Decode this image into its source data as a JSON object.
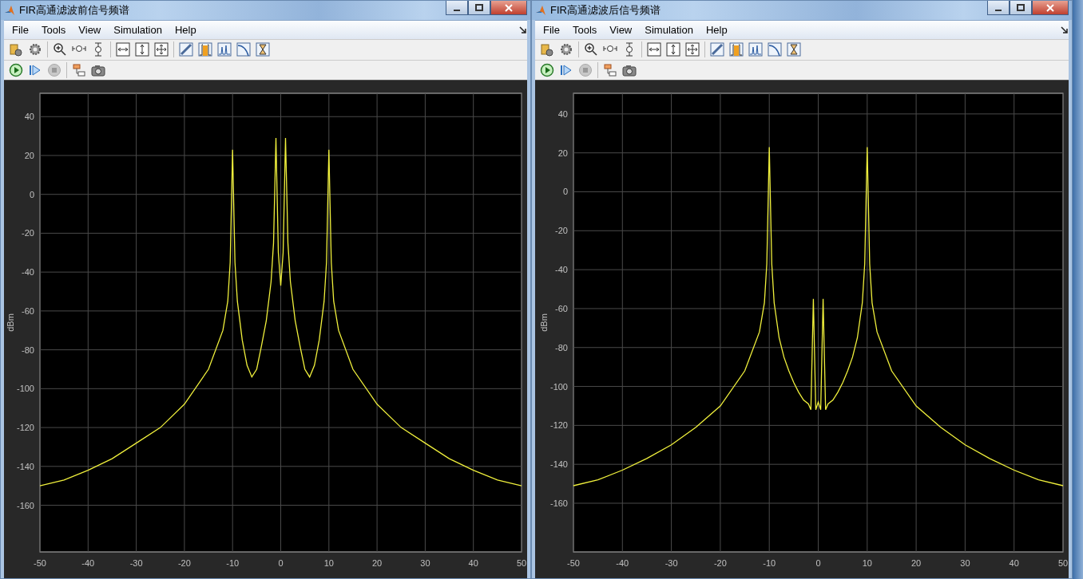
{
  "windows": [
    {
      "title": "FIR高通滤波前信号频谱",
      "menu": [
        "File",
        "Tools",
        "View",
        "Simulation",
        "Help"
      ],
      "chart_data": {
        "type": "line",
        "grid": true,
        "ylabel": "dBm",
        "xlim": [
          -50,
          50
        ],
        "ylim": [
          -184,
          52
        ],
        "xticks": [
          -50,
          -40,
          -30,
          -20,
          -10,
          0,
          10,
          20,
          30,
          40,
          50
        ],
        "yticks": [
          -160,
          -140,
          -120,
          -100,
          -80,
          -60,
          -40,
          -20,
          0,
          20,
          40
        ],
        "x": [
          -50,
          -45,
          -40,
          -35,
          -30,
          -25,
          -20,
          -15,
          -12,
          -11,
          -10.5,
          -10,
          -9.5,
          -9,
          -8,
          -7,
          -6,
          -5,
          -4,
          -3,
          -2,
          -1.5,
          -1,
          -0.5,
          0,
          0.5,
          1,
          1.5,
          2,
          3,
          4,
          5,
          6,
          7,
          8,
          9,
          9.5,
          10,
          10.5,
          11,
          12,
          15,
          20,
          25,
          30,
          35,
          40,
          45,
          50
        ],
        "series": [
          {
            "color": "#f0f03c",
            "values": [
              -150,
              -147,
              -142,
              -136,
              -128,
              -120,
              -108,
              -90,
              -70,
              -55,
              -35,
              23,
              -35,
              -55,
              -75,
              -88,
              -94,
              -90,
              -78,
              -65,
              -45,
              -25,
              29,
              -30,
              -47,
              -30,
              29,
              -25,
              -45,
              -65,
              -78,
              -90,
              -94,
              -88,
              -75,
              -55,
              -35,
              23,
              -35,
              -55,
              -70,
              -90,
              -108,
              -120,
              -128,
              -136,
              -142,
              -147,
              -150
            ]
          }
        ]
      }
    },
    {
      "title": "FIR高通滤波后信号频谱",
      "menu": [
        "File",
        "Tools",
        "View",
        "Simulation",
        "Help"
      ],
      "chart_data": {
        "type": "line",
        "grid": true,
        "ylabel": "dBm",
        "xlim": [
          -50,
          50
        ],
        "ylim": [
          -185,
          50.6
        ],
        "xticks": [
          -50,
          -40,
          -30,
          -20,
          -10,
          0,
          10,
          20,
          30,
          40,
          50
        ],
        "yticks": [
          -160,
          -140,
          -120,
          -100,
          -80,
          -60,
          -40,
          -20,
          0,
          20,
          40
        ],
        "x": [
          -50,
          -45,
          -40,
          -35,
          -30,
          -25,
          -20,
          -15,
          -12,
          -11,
          -10.5,
          -10,
          -9.5,
          -9,
          -8,
          -7,
          -6,
          -5,
          -4,
          -3,
          -2,
          -1.5,
          -1,
          -0.5,
          0,
          0.5,
          1,
          1.5,
          2,
          3,
          4,
          5,
          6,
          7,
          8,
          9,
          9.5,
          10,
          10.5,
          11,
          12,
          15,
          20,
          25,
          30,
          35,
          40,
          45,
          50
        ],
        "series": [
          {
            "color": "#f0f03c",
            "values": [
              -151,
              -148,
              -143,
              -137,
              -130,
              -121,
              -110,
              -92,
              -72,
              -57,
              -37,
              23,
              -37,
              -57,
              -75,
              -85,
              -92,
              -98,
              -103,
              -107,
              -109,
              -112,
              -55,
              -112,
              -108,
              -112,
              -55,
              -112,
              -109,
              -107,
              -103,
              -98,
              -92,
              -85,
              -75,
              -57,
              -37,
              23,
              -37,
              -57,
              -72,
              -92,
              -110,
              -121,
              -130,
              -137,
              -143,
              -148,
              -151
            ]
          }
        ]
      }
    }
  ]
}
